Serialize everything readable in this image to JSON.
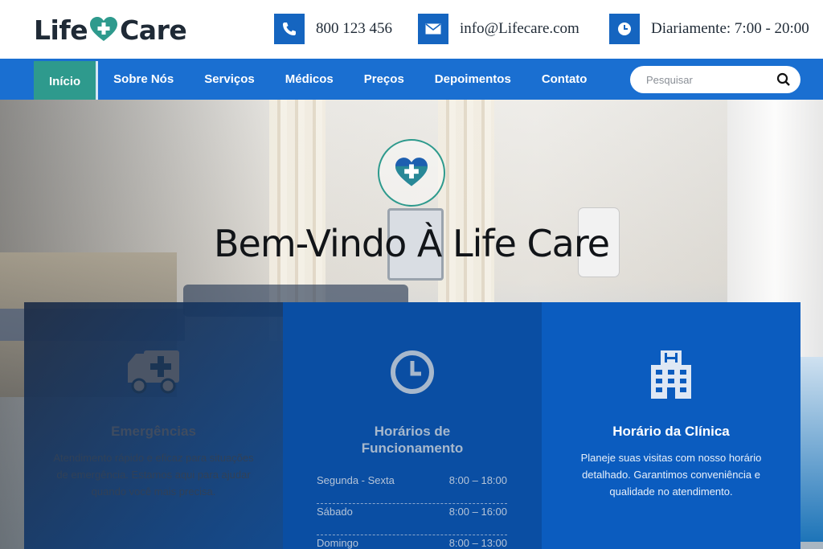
{
  "header": {
    "logo_left": "Life",
    "logo_right": "Care",
    "phone": "800 123 456",
    "email": "info@Lifecare.com",
    "hours": "Diariamente: 7:00 - 20:00"
  },
  "nav": {
    "items": [
      {
        "label": "Início"
      },
      {
        "label": "Sobre Nós"
      },
      {
        "label": "Serviços"
      },
      {
        "label": "Médicos"
      },
      {
        "label": "Preços"
      },
      {
        "label": "Depoimentos"
      },
      {
        "label": "Contato"
      }
    ],
    "search_placeholder": "Pesquisar"
  },
  "hero": {
    "title": "Bem-Vindo À Life Care"
  },
  "features": {
    "emergency": {
      "title": "Emergências",
      "text": "Atendimento rápido e eficaz para situações de emergência. Estamos aqui para ajudar quando você mais precisa."
    },
    "opening": {
      "title_line1": "Horários de",
      "title_line2": "Funcionamento",
      "rows": [
        {
          "day": "Segunda - Sexta",
          "time": "8:00 – 18:00"
        },
        {
          "day": "Sábado",
          "time": "8:00 – 16:00"
        },
        {
          "day": "Domingo",
          "time": "8:00 – 13:00"
        }
      ]
    },
    "clinic": {
      "title": "Horário da Clínica",
      "text": "Planeje suas visitas com nosso horário detalhado. Garantimos conveniência e qualidade no atendimento."
    }
  },
  "colors": {
    "primary": "#1a6fd1",
    "accent": "#2e9a8d",
    "dark": "#1f2a36"
  }
}
